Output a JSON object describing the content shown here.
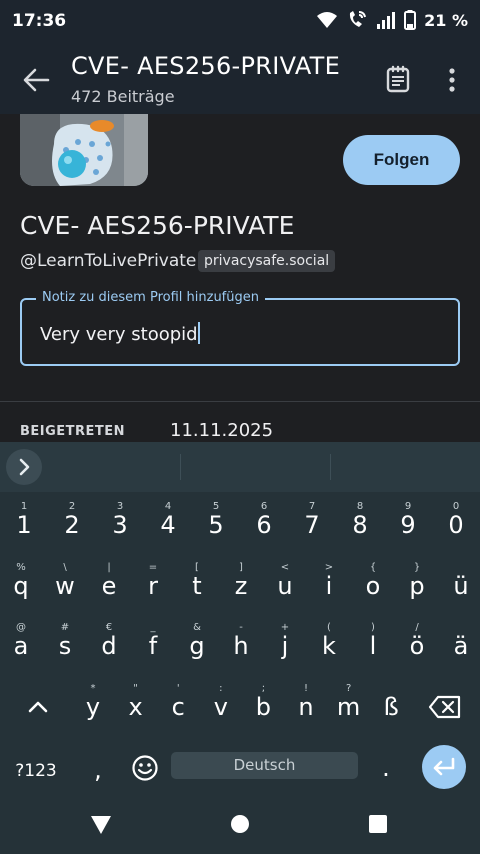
{
  "status_bar": {
    "time": "17:36",
    "battery_percent": "21 %"
  },
  "app_bar": {
    "title": "CVE- AES256-PRIVATE",
    "subtitle": "472 Beiträge"
  },
  "profile": {
    "follow_label": "Folgen",
    "display_name": "CVE- AES256-PRIVATE",
    "handle": "@LearnToLivePrivate",
    "domain": "privacysafe.social",
    "note_label": "Notiz zu diesem Profil hinzufügen",
    "note_value": "Very very stoopid",
    "joined_label": "BEIGETRETEN",
    "joined_date": "11.11.2025"
  },
  "keyboard": {
    "row_numbers": [
      "1",
      "2",
      "3",
      "4",
      "5",
      "6",
      "7",
      "8",
      "9",
      "0"
    ],
    "row_numbers_hints": [
      "1",
      "2",
      "3",
      "4",
      "5",
      "6",
      "7",
      "8",
      "9",
      "0"
    ],
    "row1": [
      "q",
      "w",
      "e",
      "r",
      "t",
      "z",
      "u",
      "i",
      "o",
      "p",
      "ü"
    ],
    "row1_hints": [
      "%",
      "\\",
      "|",
      "=",
      "[",
      "]",
      "<",
      ">",
      "{",
      "}",
      ""
    ],
    "row2": [
      "a",
      "s",
      "d",
      "f",
      "g",
      "h",
      "j",
      "k",
      "l",
      "ö",
      "ä"
    ],
    "row2_hints": [
      "@",
      "#",
      "€",
      "_",
      "&",
      "-",
      "+",
      "(",
      ")",
      "/",
      ""
    ],
    "row3": [
      "y",
      "x",
      "c",
      "v",
      "b",
      "n",
      "m",
      "ß"
    ],
    "row3_hints": [
      "*",
      "\"",
      "'",
      ":",
      ";",
      "!",
      "?",
      ""
    ],
    "symbols_label": "?123",
    "comma_label": ",",
    "period_label": ".",
    "space_label": "Deutsch",
    "accent_color": "#9ccbf3"
  }
}
